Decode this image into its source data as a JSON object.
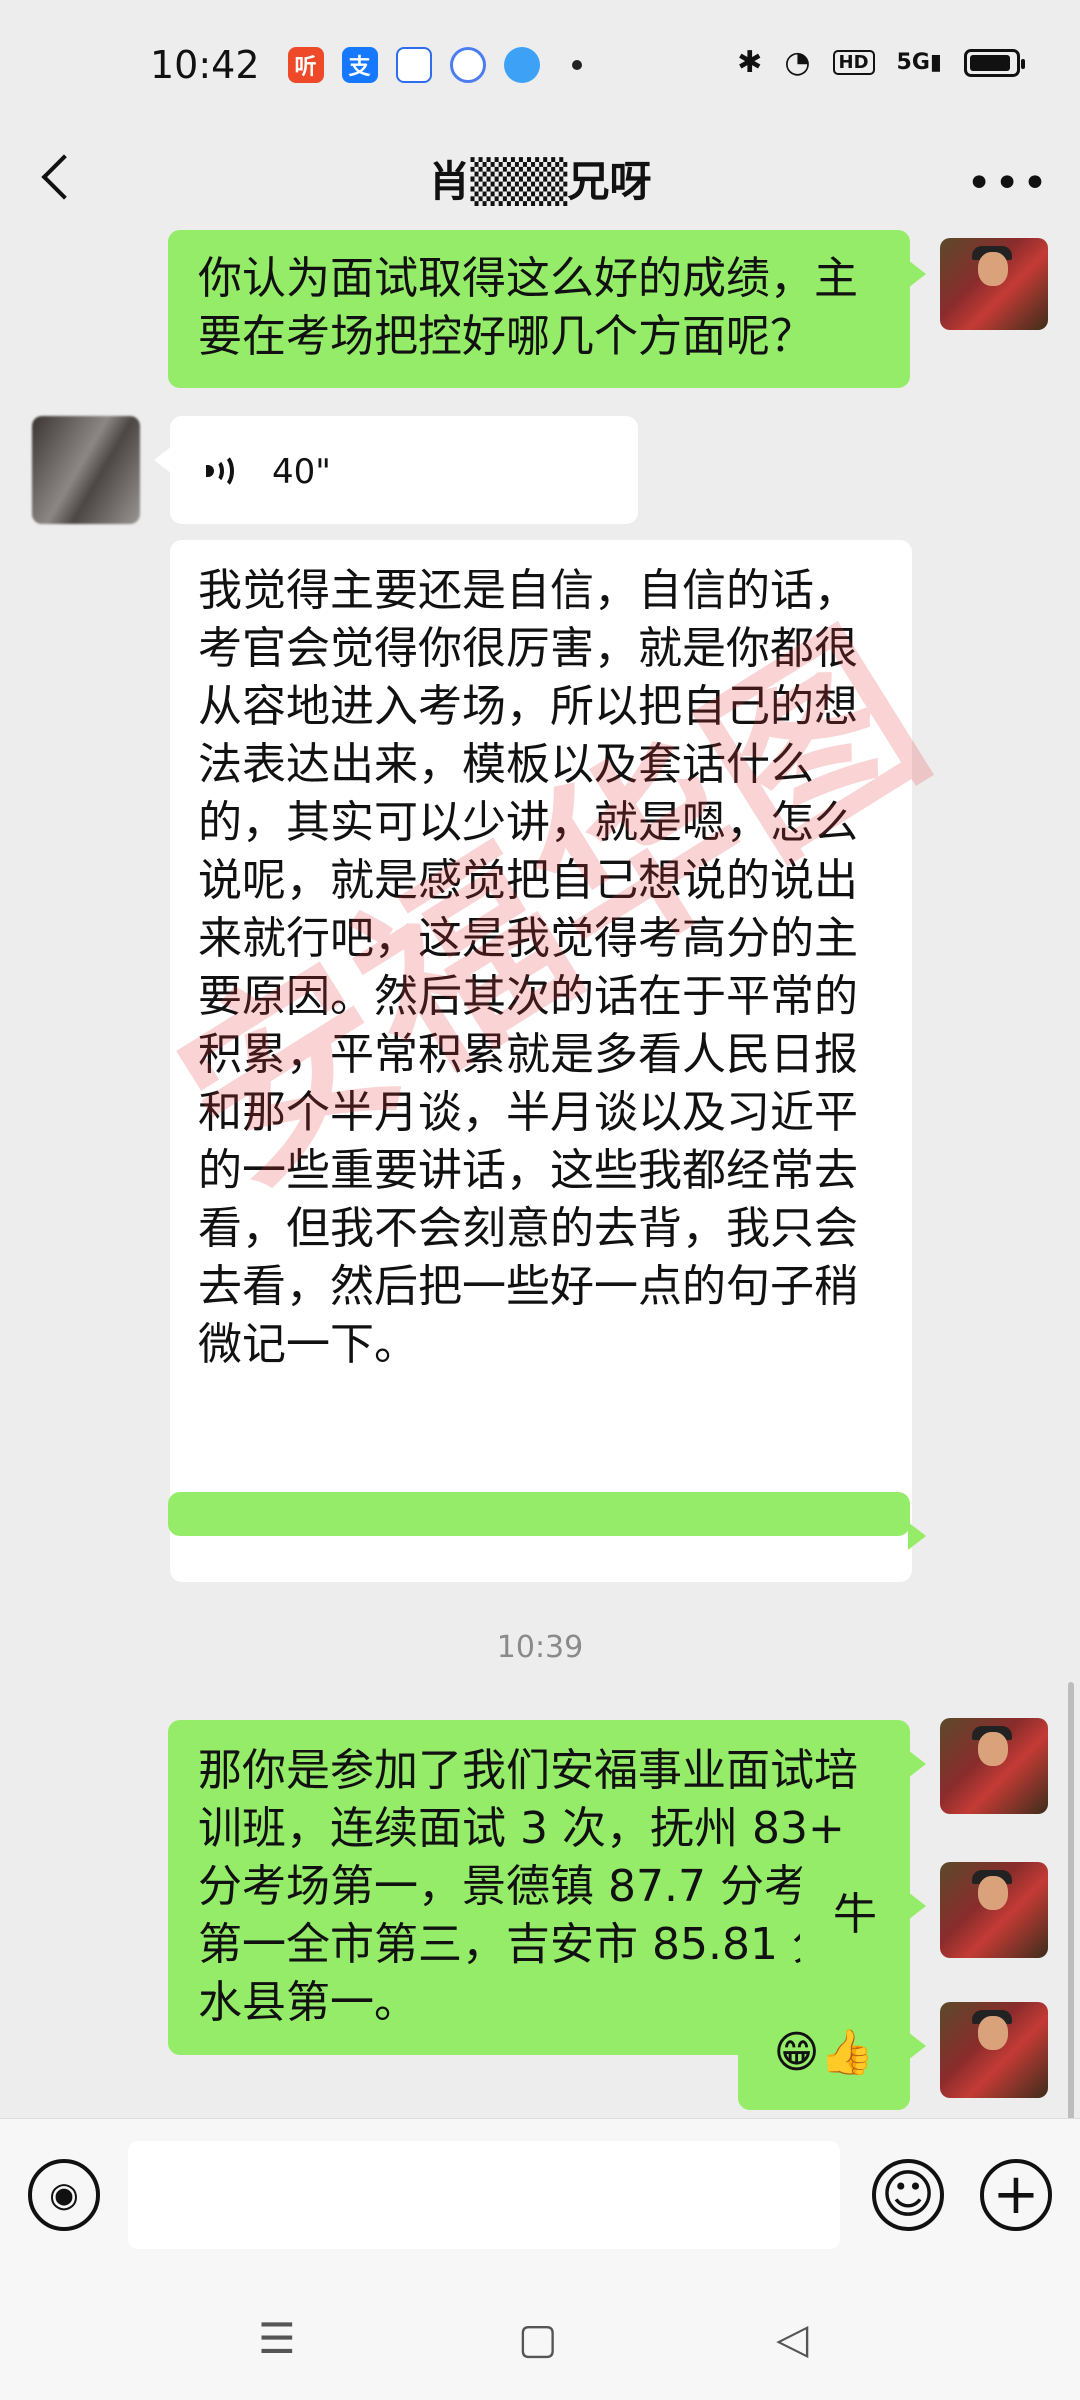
{
  "status_bar": {
    "time": "10:42",
    "app_icons": [
      {
        "name": "ting-app-icon",
        "glyph": "听",
        "color": "#ee4a2a"
      },
      {
        "name": "alipay-app-icon",
        "glyph": "支",
        "color": "#1677ff"
      },
      {
        "name": "baidu-app-icon",
        "glyph": "",
        "color": "#2f6df0"
      },
      {
        "name": "app-icon-4",
        "glyph": "",
        "color": "#4b7df2"
      },
      {
        "name": "app-icon-5",
        "glyph": "",
        "color": "#3da1f5"
      }
    ],
    "signal_label": "5G",
    "hd_label": "HD"
  },
  "nav": {
    "title": "肖▒▒▒兄呀",
    "more": "•••"
  },
  "messages": {
    "sent_question": "你认为面试取得这么好的成绩，主要在考场把控好哪几个方面呢？",
    "voice_duration": "40\"",
    "received_text": "我觉得主要还是自信，自信的话，考官会觉得你很厉害，就是你都很从容地进入考场，所以把自己的想法表达出来，模板以及套话什么的，其实可以少讲，就是嗯，怎么说呢，就是感觉把自己想说的说出来就行吧，这是我觉得考高分的主要原因。然后其次的话在于平常的积累，平常积累就是多看人民日报和那个半月谈，半月谈以及习近平的一些重要讲话，这些我都经常去看，但我不会刻意的去背，我只会去看，然后把一些好一点的句子稍微记一下。",
    "timestamp": "10:39",
    "sent_summary": "那你是参加了我们安福事业面试培训班，连续面试 3 次，抚州 83+ 分考场第一，景德镇 87.7 分考场第一全市第三，吉安市 85.81 分吉水县第一。",
    "sent_niu": "牛",
    "sent_emoji": "😁👍"
  },
  "watermark": "安福华图",
  "input_bar": {
    "voice_btn_glyph": "◉",
    "emoji_btn_glyph": "☺",
    "plus_btn_glyph": "+"
  },
  "sys_nav": {
    "menu": "☰",
    "home": "▢",
    "back": "◁"
  }
}
